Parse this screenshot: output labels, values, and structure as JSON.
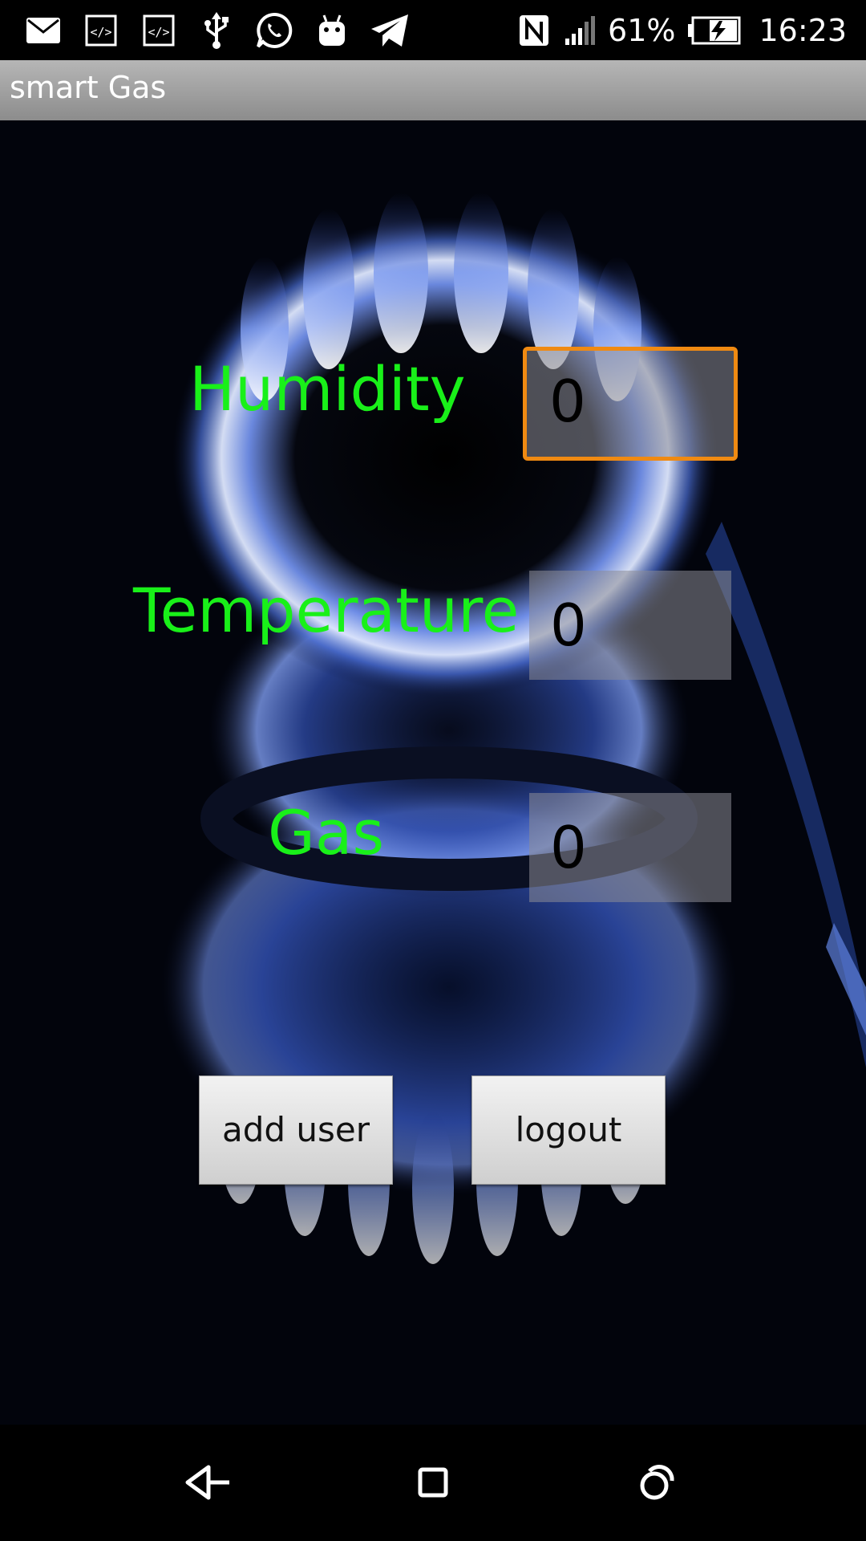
{
  "status_bar": {
    "left_icons": [
      "mail-icon",
      "code-icon",
      "code-icon",
      "usb-icon",
      "whatsapp-icon",
      "android-icon",
      "telegram-icon"
    ],
    "right_icons": [
      "nfc-icon",
      "signal-icon",
      "battery-charging-icon"
    ],
    "battery_percent": "61%",
    "time": "16:23"
  },
  "app": {
    "title": "smart Gas"
  },
  "readings": [
    {
      "label": "Humidity",
      "value": "0",
      "focused": true
    },
    {
      "label": "Temperature",
      "value": "0",
      "focused": false
    },
    {
      "label": "Gas",
      "value": "0",
      "focused": false
    }
  ],
  "buttons": {
    "add_user": "add user",
    "logout": "logout"
  },
  "nav_bar": {
    "icons": [
      "back-icon",
      "home-icon",
      "recents-icon"
    ]
  },
  "colors": {
    "label_green": "#19f019",
    "focus_orange": "#f08a12",
    "action_bar": "#a0a0a0"
  }
}
